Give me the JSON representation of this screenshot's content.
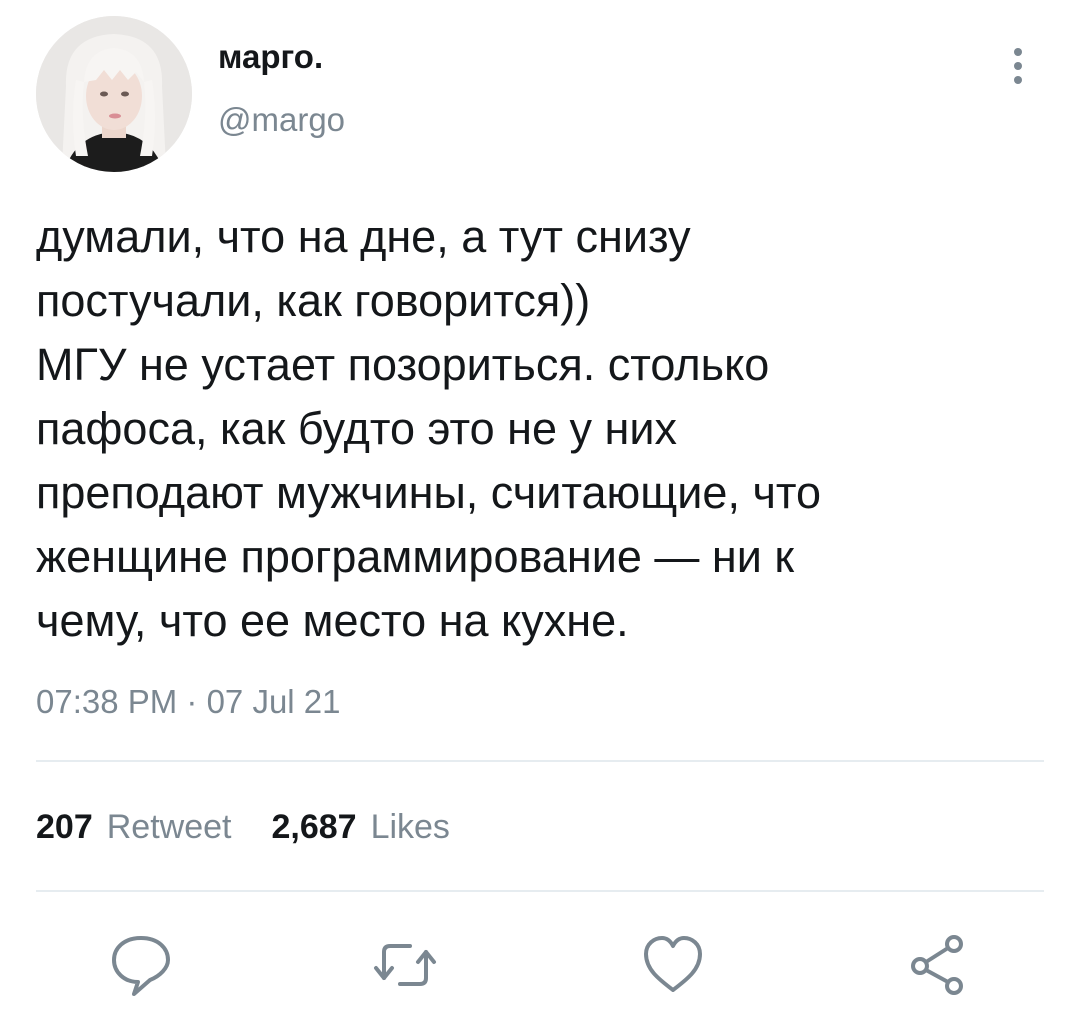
{
  "user": {
    "display_name": "марго.",
    "handle": "@margo"
  },
  "tweet": {
    "lines": [
      "думали, что на дне, а тут снизу",
      "постучали, как говорится))",
      "МГУ не устает позориться. столько",
      "пафоса, как будто это не у них",
      "преподают мужчины, считающие, что",
      "женщине программирование — ни к",
      "чему, что ее место на кухне."
    ],
    "timestamp": "07:38 PM · 07 Jul 21"
  },
  "stats": {
    "retweets_count": "207",
    "retweets_label": "Retweet",
    "likes_count": "2,687",
    "likes_label": "Likes"
  },
  "actions": {
    "reply_icon": "speech-bubble-icon",
    "retweet_icon": "retweet-arrows-icon",
    "like_icon": "heart-outline-icon",
    "share_icon": "share-nodes-icon"
  },
  "colors": {
    "text": "#14171a",
    "secondary": "#7b8791",
    "divider": "#e6ecf0",
    "background": "#ffffff"
  }
}
